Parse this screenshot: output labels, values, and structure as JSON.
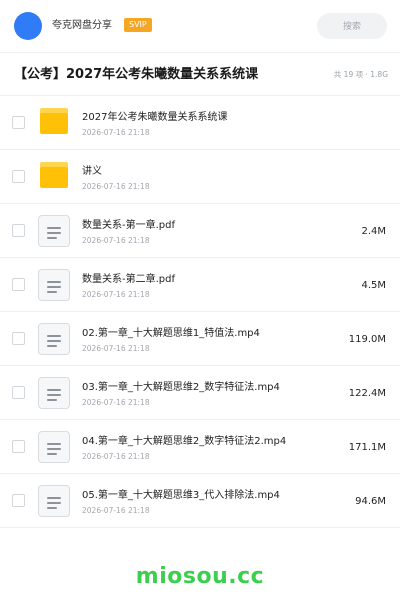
{
  "header": {
    "share_name": "夸克网盘分享",
    "badge": "SVIP",
    "search_label": "搜索",
    "avatar_color": "#2f7cf6",
    "badge_color": "#f5a623"
  },
  "folder": {
    "title": "【公考】2027年公考朱曦数量关系系统课",
    "meta": "共 19 项 · 1.8G"
  },
  "files": [
    {
      "type": "folder",
      "icon": "folder-icon",
      "name": "2027年公考朱曦数量关系系统课",
      "date": "2026-07-16 21:18",
      "size": ""
    },
    {
      "type": "folder",
      "icon": "folder-icon",
      "name": "讲义",
      "date": "2026-07-16 21:18",
      "size": ""
    },
    {
      "type": "file",
      "icon": "document-icon",
      "name": "数量关系-第一章.pdf",
      "date": "2026-07-16 21:18",
      "size": "2.4M"
    },
    {
      "type": "file",
      "icon": "document-icon",
      "name": "数量关系-第二章.pdf",
      "date": "2026-07-16 21:18",
      "size": "4.5M"
    },
    {
      "type": "file",
      "icon": "document-icon",
      "name": "02.第一章_十大解题思维1_特值法.mp4",
      "date": "2026-07-16 21:18",
      "size": "119.0M"
    },
    {
      "type": "file",
      "icon": "document-icon",
      "name": "03.第一章_十大解题思维2_数字特征法.mp4",
      "date": "2026-07-16 21:18",
      "size": "122.4M"
    },
    {
      "type": "file",
      "icon": "document-icon",
      "name": "04.第一章_十大解题思维2_数字特征法2.mp4",
      "date": "2026-07-16 21:18",
      "size": "171.1M"
    },
    {
      "type": "file",
      "icon": "document-icon",
      "name": "05.第一章_十大解题思维3_代入排除法.mp4",
      "date": "2026-07-16 21:18",
      "size": "94.6M"
    }
  ],
  "watermark": {
    "text": "miosou.cc",
    "color": "#3ccf4e"
  }
}
